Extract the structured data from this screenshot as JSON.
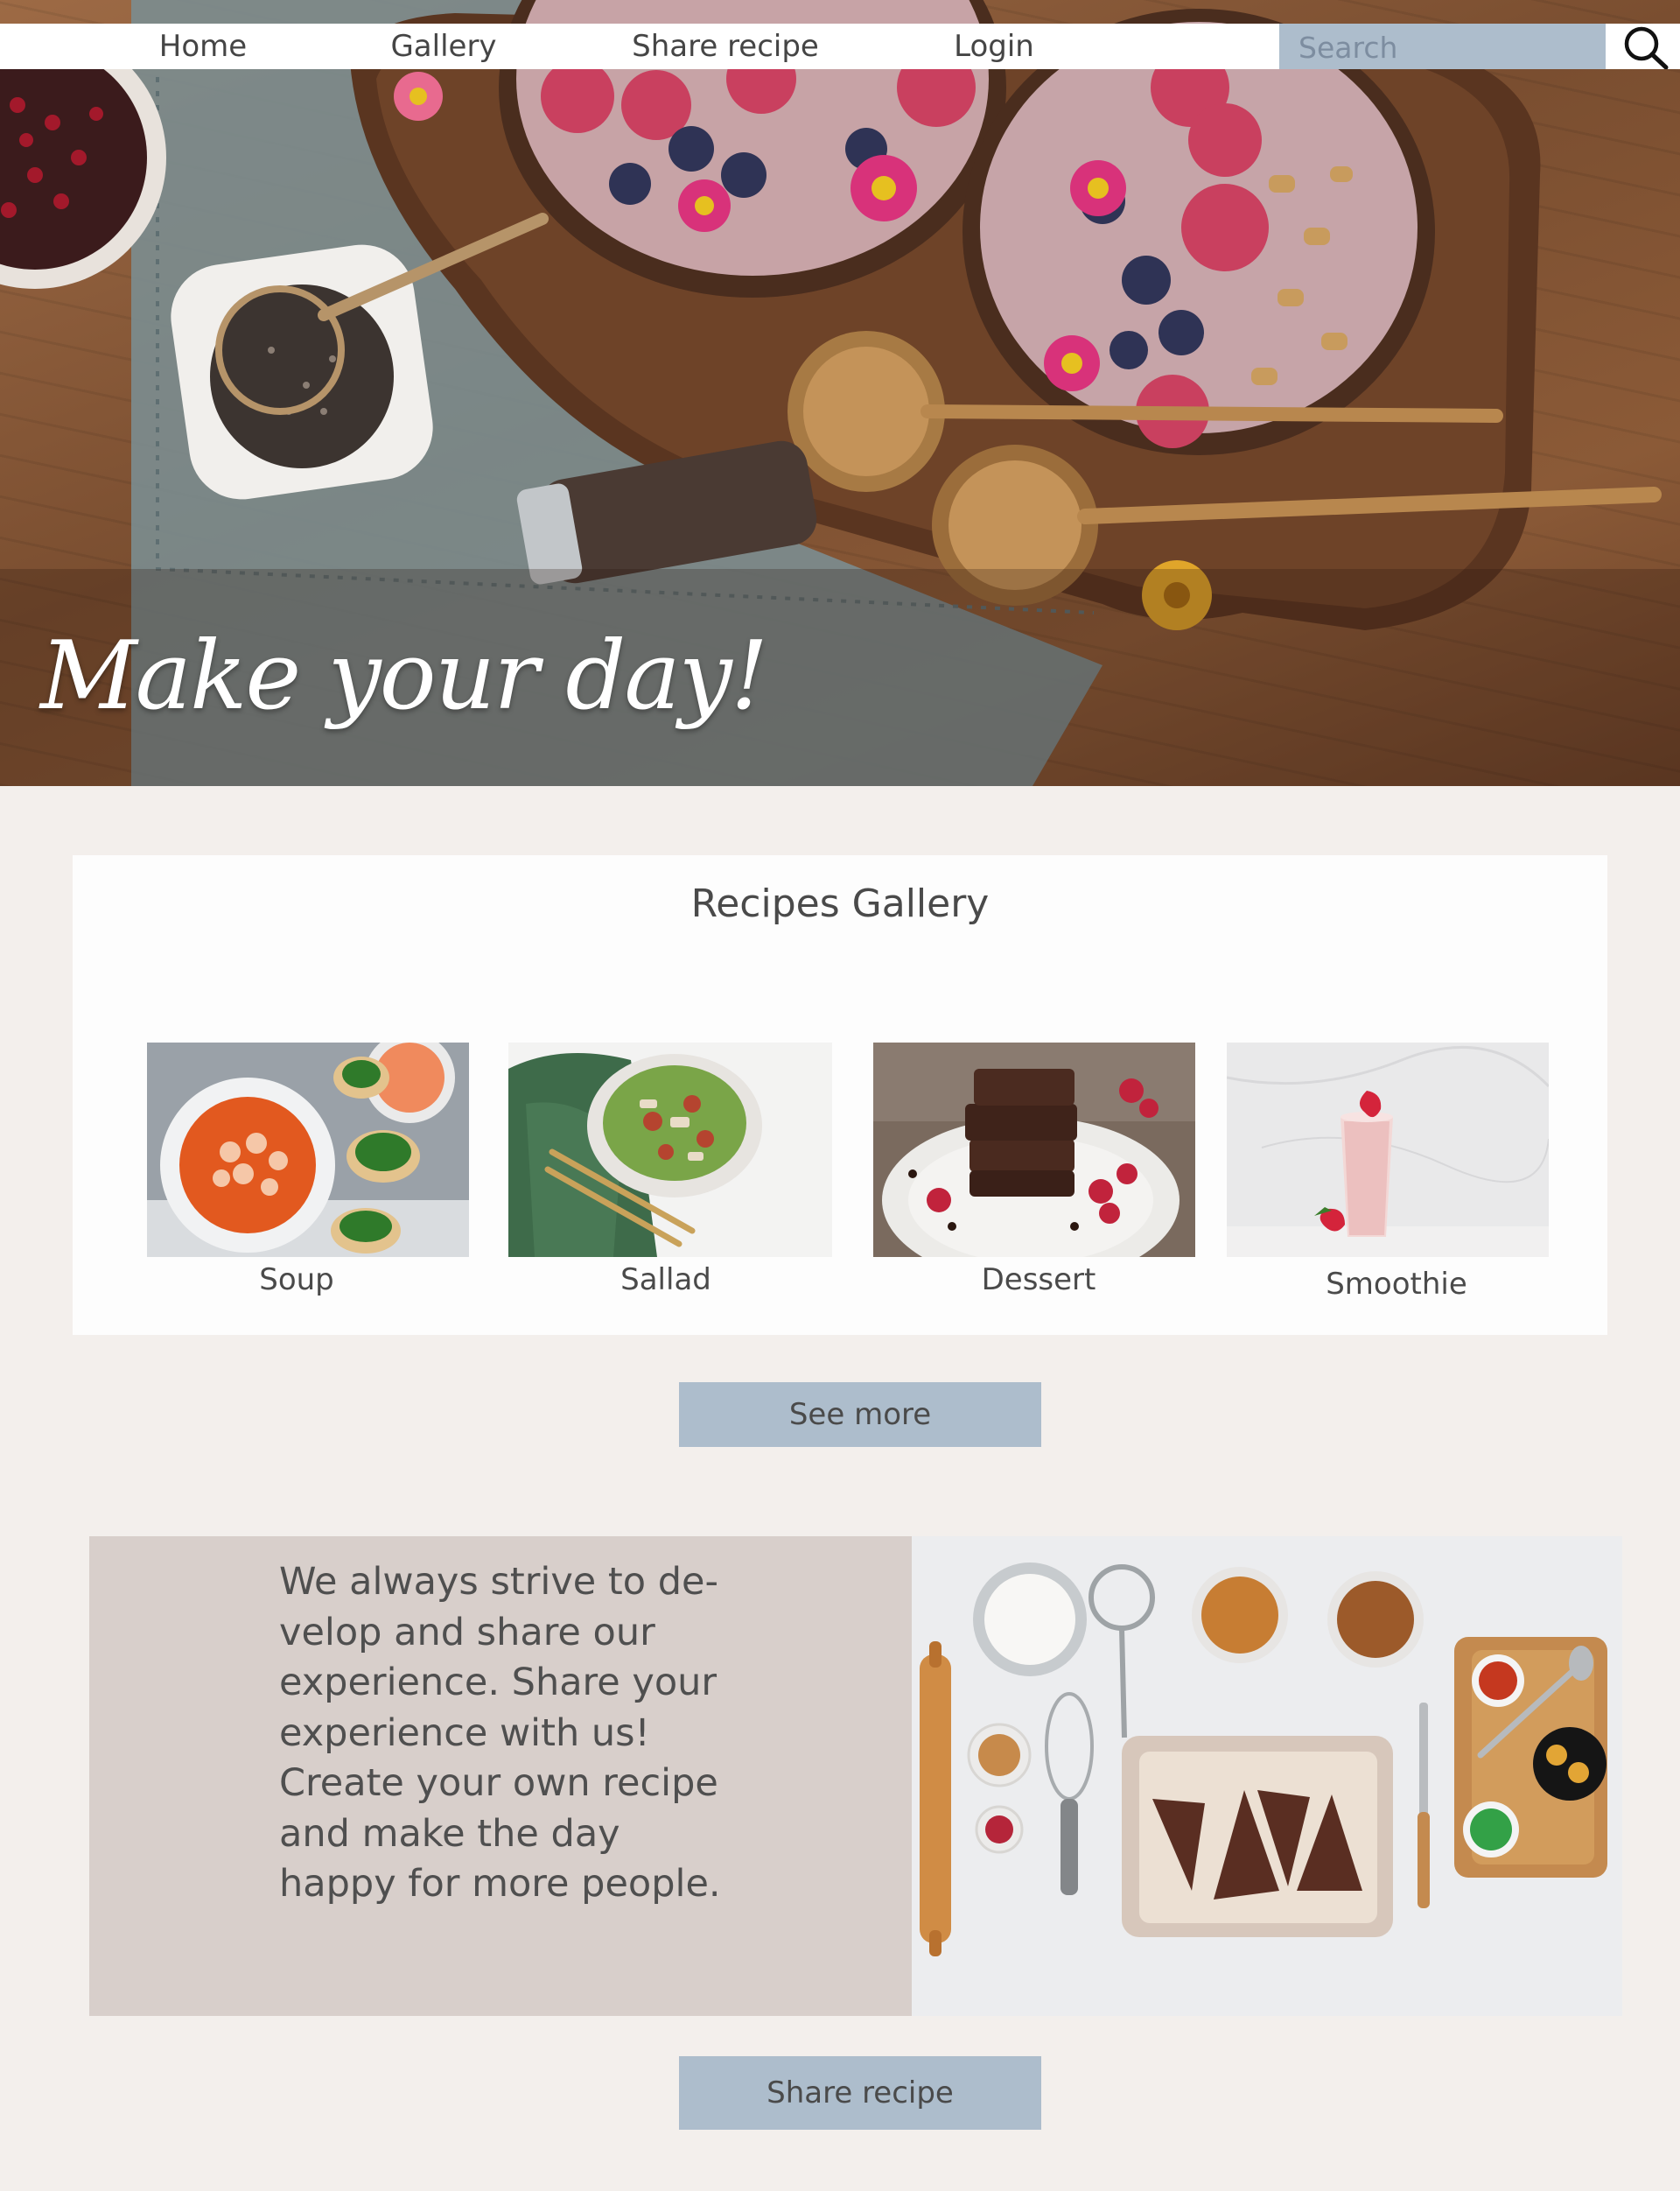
{
  "nav": {
    "home": "Home",
    "gallery": "Gallery",
    "share": "Share recipe",
    "login": "Login",
    "search_placeholder": "Search",
    "search_icon": "search-icon"
  },
  "hero": {
    "tagline": "Make your day!"
  },
  "gallery": {
    "title": "Recipes Gallery",
    "items": [
      {
        "label": "Soup"
      },
      {
        "label": "Sallad"
      },
      {
        "label": "Dessert"
      },
      {
        "label": "Smoothie"
      }
    ],
    "see_more": "See more"
  },
  "about": {
    "text": "We always strive to de-velop and share our experience. Share your experience with us! Create your own recipe and make the day happy for more people.",
    "share_button": "Share recipe"
  },
  "colors": {
    "page_bg": "#f3efec",
    "accent_button": "#adbdcc",
    "about_panel": "#d8cfcb",
    "text": "#4a4a4a"
  }
}
